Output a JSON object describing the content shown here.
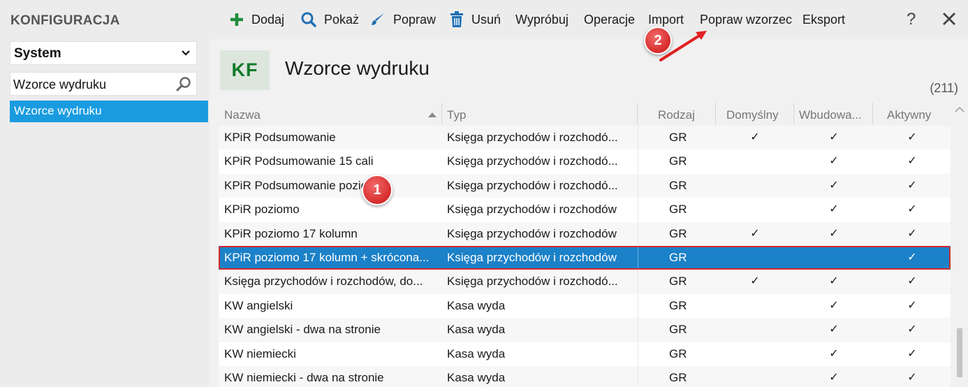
{
  "sidebar": {
    "title": "KONFIGURACJA",
    "system_select": "System",
    "search_value": "Wzorce wydruku",
    "nav_item": "Wzorce wydruku"
  },
  "toolbar": {
    "add": "Dodaj",
    "show": "Pokaż",
    "edit": "Popraw",
    "delete": "Usuń",
    "try": "Wypróbuj",
    "operations": "Operacje",
    "import": "Import",
    "edit_template": "Popraw wzorzec",
    "export": "Eksport",
    "help": "?"
  },
  "header": {
    "badge": "KF",
    "title": "Wzorce wydruku",
    "count": "(211)"
  },
  "columns": {
    "name": "Nazwa",
    "type": "Typ",
    "kind": "Rodzaj",
    "default": "Domyślny",
    "builtin": "Wbudowa...",
    "active": "Aktywny"
  },
  "rows": [
    {
      "name": "KPiR Podsumowanie",
      "type": "Księga przychodów i rozchodó...",
      "kind": "GR",
      "default": "✓",
      "builtin": "✓",
      "active": "✓"
    },
    {
      "name": "KPiR Podsumowanie 15 cali",
      "type": "Księga przychodów i rozchodó...",
      "kind": "GR",
      "default": "",
      "builtin": "✓",
      "active": "✓"
    },
    {
      "name": "KPiR Podsumowanie poziomo",
      "type": "Księga przychodów i rozchodó...",
      "kind": "GR",
      "default": "",
      "builtin": "✓",
      "active": "✓"
    },
    {
      "name": "KPiR poziomo",
      "type": "Księga przychodów i rozchodów",
      "kind": "GR",
      "default": "",
      "builtin": "✓",
      "active": "✓"
    },
    {
      "name": "KPiR poziomo 17 kolumn",
      "type": "Księga przychodów i rozchodów",
      "kind": "GR",
      "default": "✓",
      "builtin": "✓",
      "active": "✓"
    },
    {
      "name": "KPiR poziomo 17 kolumn + skrócona...",
      "type": "Księga przychodów i rozchodów",
      "kind": "GR",
      "default": "",
      "builtin": "",
      "active": "✓"
    },
    {
      "name": "Księga przychodów i rozchodów, do...",
      "type": "Księga przychodów i rozchodó...",
      "kind": "GR",
      "default": "✓",
      "builtin": "✓",
      "active": "✓"
    },
    {
      "name": "KW angielski",
      "type": "Kasa wyda",
      "kind": "GR",
      "default": "",
      "builtin": "✓",
      "active": "✓"
    },
    {
      "name": "KW angielski - dwa na stronie",
      "type": "Kasa wyda",
      "kind": "GR",
      "default": "",
      "builtin": "✓",
      "active": "✓"
    },
    {
      "name": "KW niemiecki",
      "type": "Kasa wyda",
      "kind": "GR",
      "default": "",
      "builtin": "✓",
      "active": "✓"
    },
    {
      "name": "KW niemiecki - dwa na stronie",
      "type": "Kasa wyda",
      "kind": "GR",
      "default": "",
      "builtin": "✓",
      "active": "✓"
    }
  ],
  "annotations": {
    "step1": "1",
    "step2": "2"
  },
  "colors": {
    "accent": "#1a9be0",
    "selected_row": "#1b81c8",
    "highlight": "#d42a2a",
    "add_icon": "#1e8c3a",
    "icon_blue": "#1f6fb5"
  }
}
